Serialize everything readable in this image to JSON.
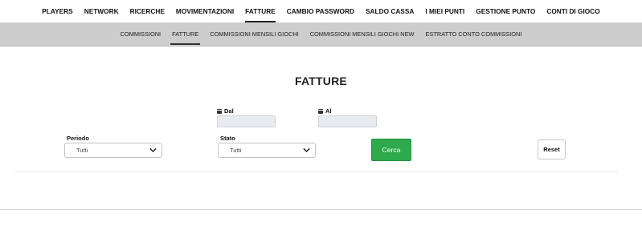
{
  "topnav": {
    "items": [
      {
        "label": "PLAYERS"
      },
      {
        "label": "NETWORK"
      },
      {
        "label": "RICERCHE"
      },
      {
        "label": "MOVIMENTAZIONI"
      },
      {
        "label": "FATTURE",
        "active": true
      },
      {
        "label": "CAMBIO PASSWORD"
      },
      {
        "label": "SALDO CASSA"
      },
      {
        "label": "I MIEI PUNTI"
      },
      {
        "label": "GESTIONE PUNTO"
      },
      {
        "label": "CONTI DI GIOCO"
      }
    ]
  },
  "subnav": {
    "items": [
      {
        "label": "COMMISSIONI"
      },
      {
        "label": "FATTURE",
        "active": true
      },
      {
        "label": "COMMISSIONI MENSILI GIOCHI"
      },
      {
        "label": "COMMISSIONI MENSILI GIOCHI NEW"
      },
      {
        "label": "ESTRATTO CONTO COMMISSIONI"
      }
    ]
  },
  "page": {
    "title": "FATTURE"
  },
  "filters": {
    "dal": {
      "label": "Dal",
      "value": "",
      "icon": "calendar-icon"
    },
    "al": {
      "label": "Al",
      "value": "",
      "icon": "calendar-icon"
    },
    "periodo": {
      "label": "Periodo",
      "selected": "Tutti"
    },
    "stato": {
      "label": "Stato",
      "selected": "Tutti"
    }
  },
  "actions": {
    "cerca": "Cerca",
    "reset": "Reset"
  },
  "colors": {
    "subnav_bg": "#cdcdcd",
    "primary_green": "#2eaa4c",
    "input_bg": "#e8ebef"
  }
}
